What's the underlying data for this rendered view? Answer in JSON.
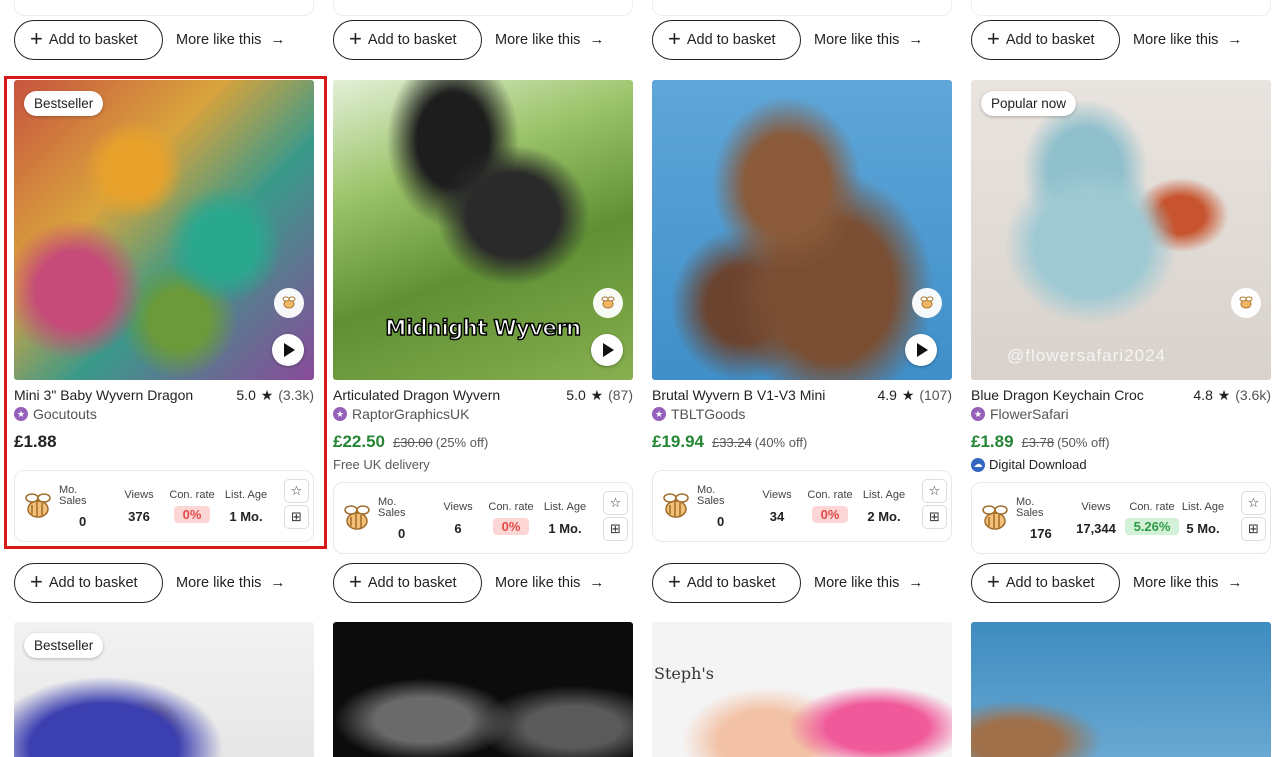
{
  "buttons": {
    "add_basket": "Add to basket",
    "more_like": "More like this"
  },
  "stat_labels": {
    "mo_sales": "Mo.\nSales",
    "views": "Views",
    "con_rate": "Con. rate",
    "list_age": "List. Age"
  },
  "products": [
    {
      "badge": "Bestseller",
      "title": "Mini 3\" Baby Wyvern Dragon",
      "rating": "5.0",
      "reviews": "(3.3k)",
      "shop": "Gocutouts",
      "price": "£1.88",
      "old_price": "",
      "discount": "",
      "subline": "",
      "stats": {
        "sales": "0",
        "views": "376",
        "conv": "0%",
        "age": "1 Mo."
      }
    },
    {
      "badge": "",
      "title": "Articulated Dragon Wyvern",
      "rating": "5.0",
      "reviews": "(87)",
      "shop": "RaptorGraphicsUK",
      "price": "£22.50",
      "old_price": "£30.00",
      "discount": "(25% off)",
      "subline": "Free UK delivery",
      "image_text": "Midnight Wyvern",
      "stats": {
        "sales": "0",
        "views": "6",
        "conv": "0%",
        "age": "1 Mo."
      }
    },
    {
      "badge": "",
      "title": "Brutal Wyvern B V1-V3 Mini",
      "rating": "4.9",
      "reviews": "(107)",
      "shop": "TBLTGoods",
      "price": "£19.94",
      "old_price": "£33.24",
      "discount": "(40% off)",
      "subline": "",
      "stats": {
        "sales": "0",
        "views": "34",
        "conv": "0%",
        "age": "2 Mo."
      }
    },
    {
      "badge": "Popular now",
      "title": "Blue Dragon Keychain Croc",
      "rating": "4.8",
      "reviews": "(3.6k)",
      "shop": "FlowerSafari",
      "price": "£1.89",
      "old_price": "£3.78",
      "discount": "(50% off)",
      "subline": "Digital Download",
      "image_text": "@flowersafari2024",
      "stats": {
        "sales": "176",
        "views": "17,344",
        "conv": "5.26%",
        "age": "5 Mo."
      }
    }
  ],
  "next_row": [
    {
      "badge": "Bestseller"
    },
    {
      "badge": ""
    },
    {
      "badge": "",
      "image_text": "Steph's"
    },
    {
      "badge": ""
    }
  ],
  "colors": {
    "sale_price": "#258635",
    "highlight": "#d71818",
    "conv_red": "#e24a4a",
    "conv_green": "#2e9b45"
  }
}
